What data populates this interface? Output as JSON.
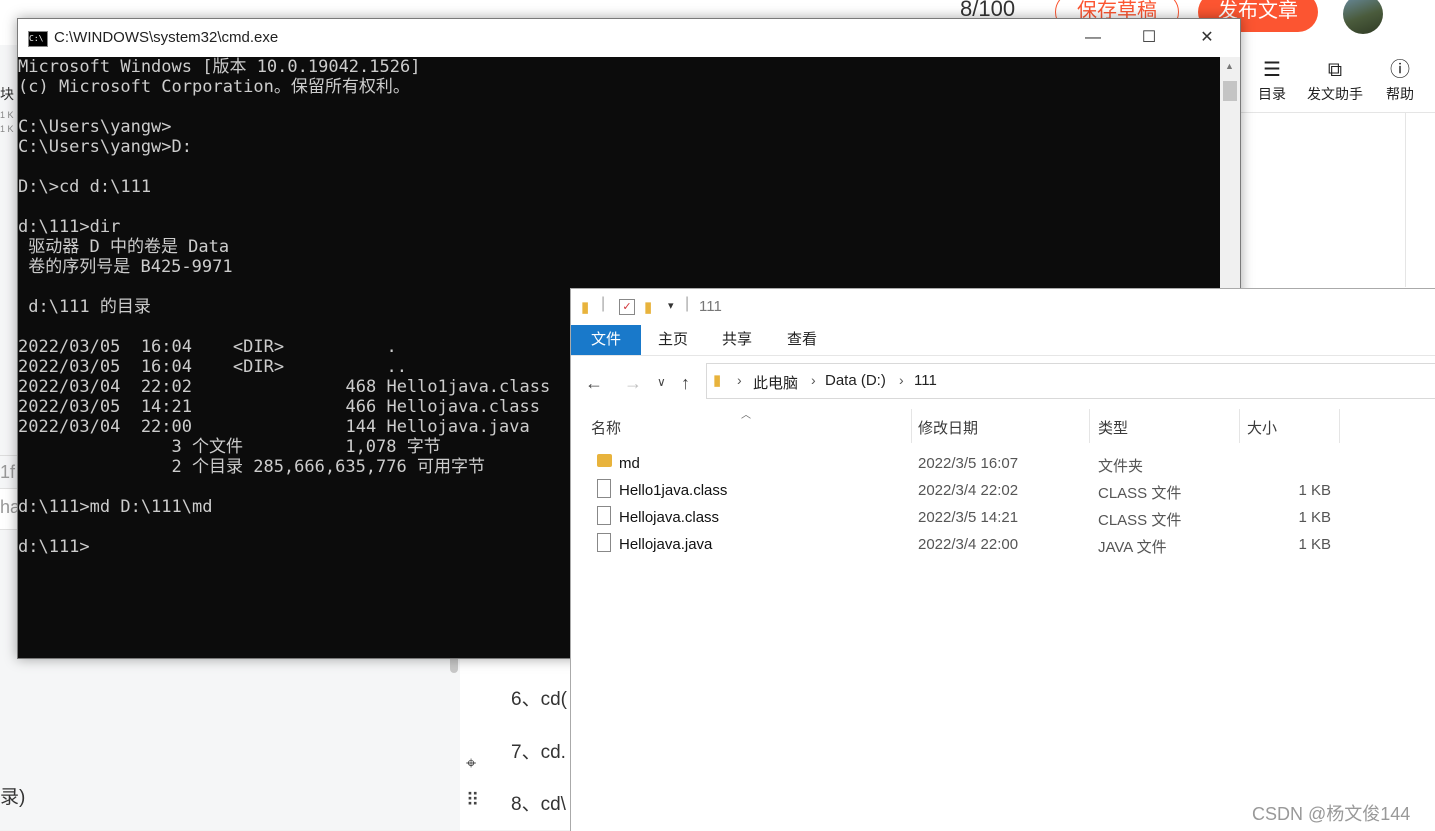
{
  "editor": {
    "word_count": "8/100",
    "save_draft_label": "保存草稿",
    "publish_label": "发布文章",
    "toolbar": {
      "catalog": "目录",
      "assistant": "发文助手",
      "help": "帮助"
    },
    "lines": [
      "6、cd(",
      "7、cd.",
      "8、cd\\"
    ],
    "left_fragments": [
      "块",
      "1 K\n1 K",
      "录)",
      "1f",
      "ha"
    ],
    "watermark": "CSDN @杨文俊144"
  },
  "cmd": {
    "title": "C:\\WINDOWS\\system32\\cmd.exe",
    "lines": [
      "Microsoft Windows [版本 10.0.19042.1526]",
      "(c) Microsoft Corporation。保留所有权利。",
      "",
      "C:\\Users\\yangw>",
      "C:\\Users\\yangw>D:",
      "",
      "D:\\>cd d:\\111",
      "",
      "d:\\111>dir",
      " 驱动器 D 中的卷是 Data",
      " 卷的序列号是 B425-9971",
      "",
      " d:\\111 的目录",
      "",
      "2022/03/05  16:04    <DIR>          .",
      "2022/03/05  16:04    <DIR>          ..",
      "2022/03/04  22:02               468 Hello1java.class",
      "2022/03/05  14:21               466 Hellojava.class",
      "2022/03/04  22:00               144 Hellojava.java",
      "               3 个文件          1,078 字节",
      "               2 个目录 285,666,635,776 可用字节",
      "",
      "d:\\111>md D:\\111\\md",
      "",
      "d:\\111>"
    ]
  },
  "explorer": {
    "title": "111",
    "tabs": {
      "file": "文件",
      "home": "主页",
      "share": "共享",
      "view": "查看"
    },
    "breadcrumb": [
      "此电脑",
      "Data (D:)",
      "111"
    ],
    "columns": {
      "name": "名称",
      "date": "修改日期",
      "type": "类型",
      "size": "大小"
    },
    "files": [
      {
        "name": "md",
        "date": "2022/3/5 16:07",
        "type": "文件夹",
        "size": "",
        "icon": "folder-icon"
      },
      {
        "name": "Hello1java.class",
        "date": "2022/3/4 22:02",
        "type": "CLASS 文件",
        "size": "1 KB",
        "icon": "file-icon"
      },
      {
        "name": "Hellojava.class",
        "date": "2022/3/5 14:21",
        "type": "CLASS 文件",
        "size": "1 KB",
        "icon": "file-icon"
      },
      {
        "name": "Hellojava.java",
        "date": "2022/3/4 22:00",
        "type": "JAVA 文件",
        "size": "1 KB",
        "icon": "file-icon"
      }
    ]
  },
  "colors": {
    "accent": "#fc5531",
    "ribbon_file": "#1979ca",
    "console_bg": "#0c0c0c",
    "console_text": "#cccccc",
    "folder": "#e8b33c"
  }
}
